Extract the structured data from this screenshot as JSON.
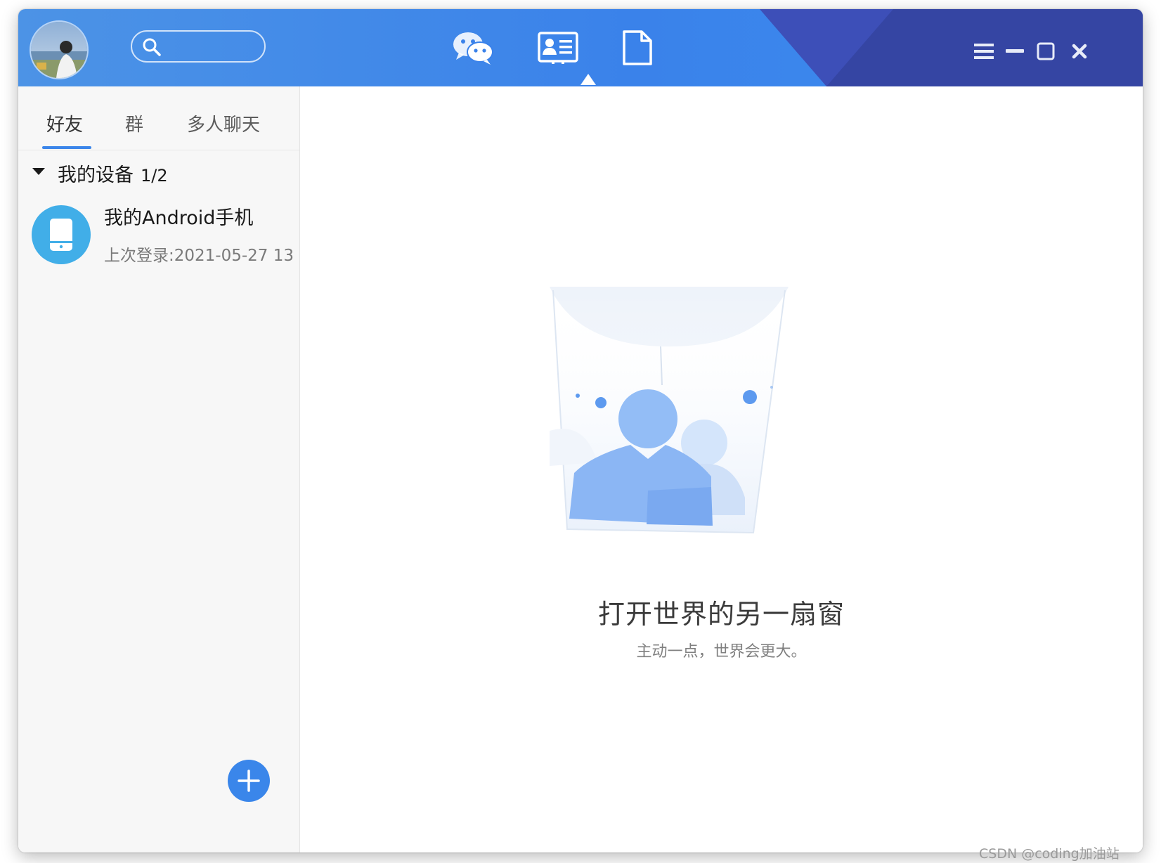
{
  "header": {
    "search": {
      "placeholder": ""
    },
    "nav": [
      {
        "name": "chat",
        "icon": "wechat-bubbles-icon"
      },
      {
        "name": "contacts",
        "icon": "contact-card-icon",
        "active": true
      },
      {
        "name": "files",
        "icon": "file-icon"
      }
    ],
    "controls": [
      "menu-icon",
      "minimize-icon",
      "maximize-icon",
      "close-icon"
    ],
    "colors": {
      "bar": "#3a82ea",
      "accent_dark": "#3545a3"
    }
  },
  "sidebar": {
    "tabs": [
      {
        "label": "好友",
        "active": true
      },
      {
        "label": "群"
      },
      {
        "label": "多人聊天"
      }
    ],
    "group": {
      "name": "我的设备",
      "count": "1/2",
      "expanded": true
    },
    "devices": [
      {
        "title": "我的Android手机",
        "last_login": "上次登录:2021-05-27 13"
      }
    ]
  },
  "main": {
    "empty_title": "打开世界的另一扇窗",
    "empty_subtitle": "主动一点，世界会更大。"
  },
  "watermark": "CSDN @coding加油站"
}
